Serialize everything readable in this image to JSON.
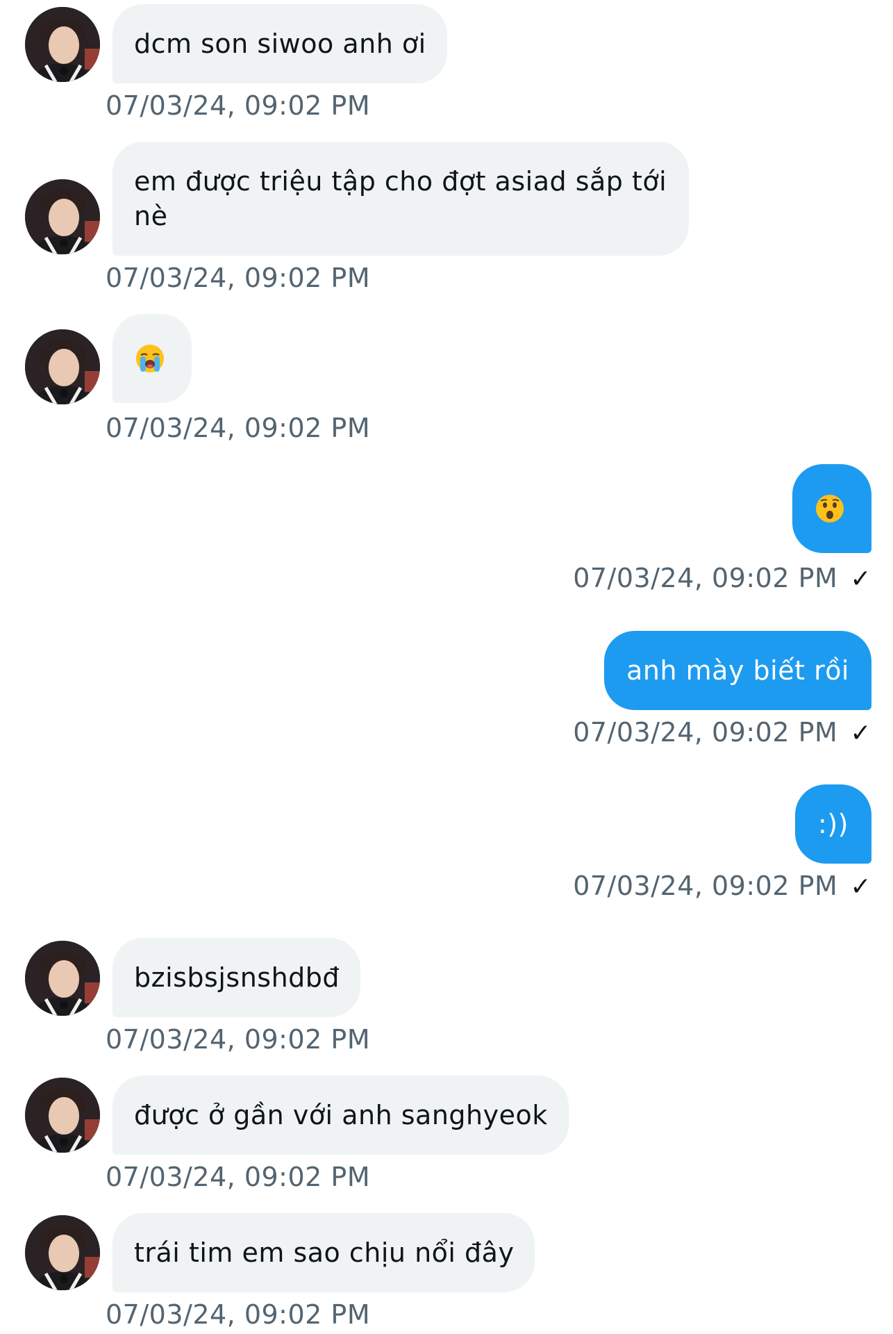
{
  "messages": [
    {
      "side": "in",
      "text": "dcm son siwoo anh ơi",
      "time": "07/03/24, 09:02 PM"
    },
    {
      "side": "in",
      "text": "em được triệu tập cho đợt asiad sắp tới nè",
      "time": "07/03/24, 09:02 PM"
    },
    {
      "side": "in",
      "emoji": "loudly-crying-face",
      "time": "07/03/24, 09:02 PM"
    },
    {
      "side": "out",
      "emoji": "hushed-face",
      "time": "07/03/24, 09:02 PM",
      "status": "✓"
    },
    {
      "side": "out",
      "text": "anh mày biết rồi",
      "time": "07/03/24, 09:02 PM",
      "status": "✓"
    },
    {
      "side": "out",
      "text": ":))",
      "time": "07/03/24, 09:02 PM",
      "status": "✓"
    },
    {
      "side": "in",
      "text": "bzisbsjsnshdbđ",
      "time": "07/03/24, 09:02 PM"
    },
    {
      "side": "in",
      "text": "được ở gần với anh sanghyeok",
      "time": "07/03/24, 09:02 PM"
    },
    {
      "side": "in",
      "text": "trái tim em sao chịu nổi đây",
      "time": "07/03/24, 09:02 PM"
    }
  ],
  "colors": {
    "incoming_bubble": "#eff3f4",
    "outgoing_bubble": "#1d9bf0",
    "timestamp": "#536471",
    "text": "#0f1419"
  }
}
